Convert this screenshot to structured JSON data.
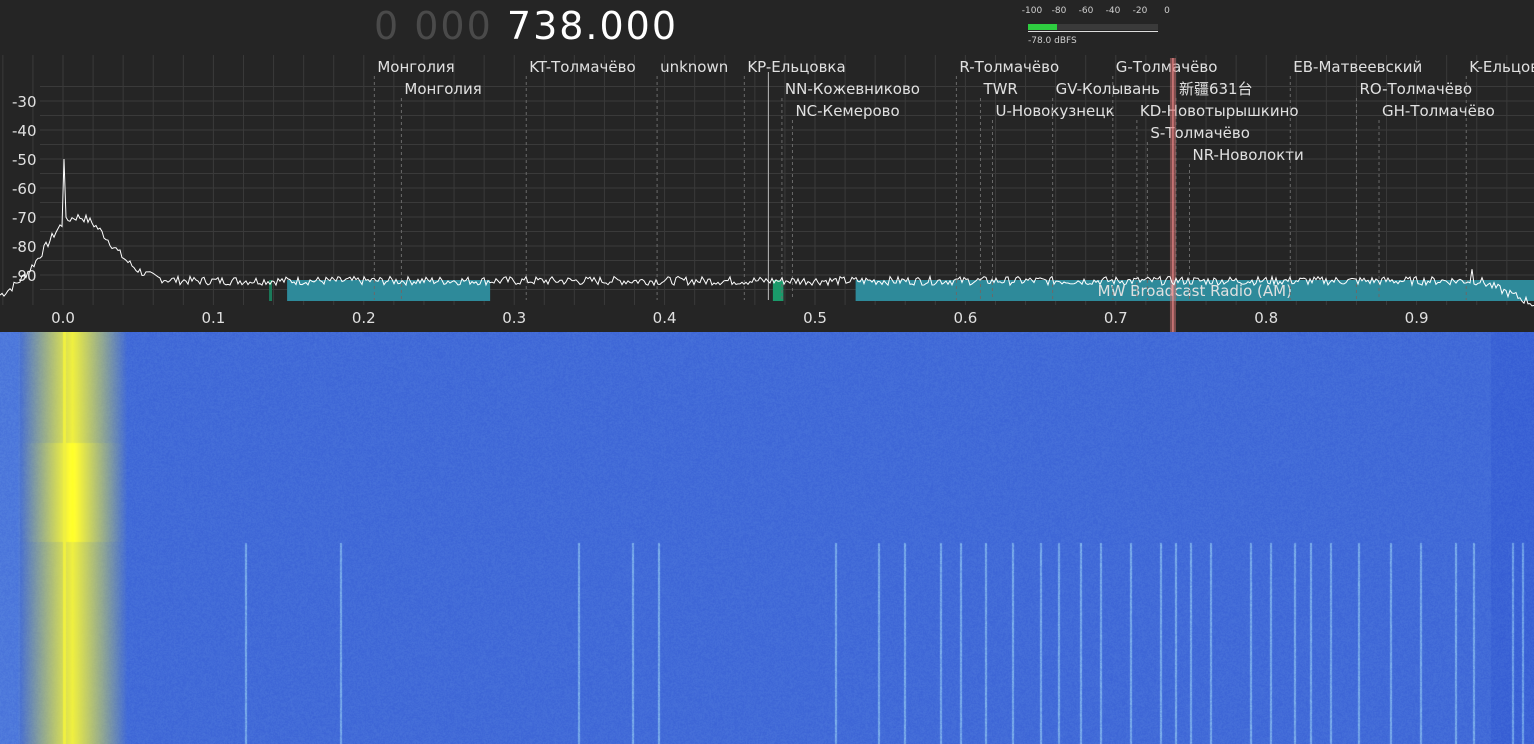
{
  "frequency": {
    "dim_digits": "0 000",
    "main_digits": "738.000"
  },
  "signal_meter": {
    "scale": [
      "-100",
      "-80",
      "-60",
      "-40",
      "-20",
      "0"
    ],
    "readout": "-78.0 dBFS",
    "level_fraction": 0.22,
    "fill_color": "#2ecc40"
  },
  "y_axis": {
    "labels": [
      "-30",
      "-40",
      "-50",
      "-60",
      "-70",
      "-80",
      "-90"
    ],
    "values": [
      -30,
      -40,
      -50,
      -60,
      -70,
      -80,
      -90
    ]
  },
  "x_axis": {
    "labels": [
      "0.0",
      "0.1",
      "0.2",
      "0.3",
      "0.4",
      "0.5",
      "0.6",
      "0.7",
      "0.8",
      "0.9"
    ],
    "values": [
      0.0,
      0.1,
      0.2,
      0.3,
      0.4,
      0.5,
      0.6,
      0.7,
      0.8,
      0.9
    ]
  },
  "stations": [
    {
      "label": "Монголия",
      "freq": 0.209,
      "row": 0
    },
    {
      "label": "Монголия",
      "freq": 0.227,
      "row": 1
    },
    {
      "label": "KT-Толмачёво",
      "freq": 0.31,
      "row": 0
    },
    {
      "label": "unknown",
      "freq": 0.397,
      "row": 0
    },
    {
      "label": "KP-Ельцовка",
      "freq": 0.455,
      "row": 0
    },
    {
      "label": "NN-Кожевниково",
      "freq": 0.48,
      "row": 1
    },
    {
      "label": "NC-Кемерово",
      "freq": 0.487,
      "row": 2
    },
    {
      "label": "R-Толмачёво",
      "freq": 0.596,
      "row": 0
    },
    {
      "label": "TWR",
      "freq": 0.612,
      "row": 1
    },
    {
      "label": "U-Новокузнецк",
      "freq": 0.62,
      "row": 2
    },
    {
      "label": "GV-Колывань",
      "freq": 0.66,
      "row": 1
    },
    {
      "label": "G-Толмачёво",
      "freq": 0.7,
      "row": 0
    },
    {
      "label": "新疆631台",
      "freq": 0.742,
      "row": 1
    },
    {
      "label": "KD-Новотырышкино",
      "freq": 0.716,
      "row": 2
    },
    {
      "label": "S-Толмачёво",
      "freq": 0.723,
      "row": 3
    },
    {
      "label": "NR-Новолокти",
      "freq": 0.751,
      "row": 4
    },
    {
      "label": "EB-Матвеевский",
      "freq": 0.818,
      "row": 0
    },
    {
      "label": "RO-Толмачёво",
      "freq": 0.862,
      "row": 1
    },
    {
      "label": "GH-Толмачёво",
      "freq": 0.877,
      "row": 2
    },
    {
      "label": "K-Ельцов",
      "freq": 0.935,
      "row": 0
    }
  ],
  "bands": [
    {
      "label": "",
      "start": 0.137,
      "end": 0.139,
      "color": "#1a7a5a"
    },
    {
      "label": "",
      "start": 0.149,
      "end": 0.284,
      "color": "#2e8a9a"
    },
    {
      "label": "",
      "start": 0.472,
      "end": 0.479,
      "color": "#1a9a6a"
    },
    {
      "label": "MW Broadcast Radio (AM)",
      "start": 0.527,
      "end": 1.02,
      "color": "#2e8a9a"
    }
  ],
  "tuned_frequency": 0.738,
  "colors": {
    "background": "#252525",
    "grid": "#3a3a3a",
    "trace": "#ffffff",
    "tuner_marker": "#c87070",
    "waterfall_base": "#2a4fd0",
    "waterfall_hot": "#f0f040"
  }
}
